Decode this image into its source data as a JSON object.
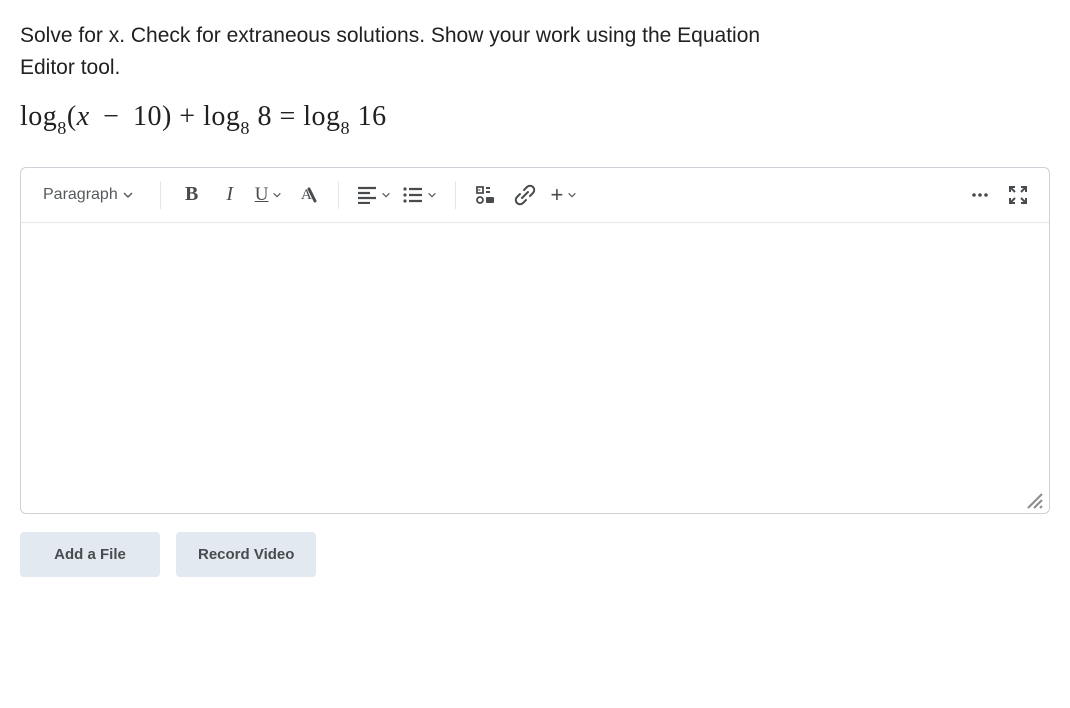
{
  "question": {
    "line1": "Solve for x.  Check for extraneous solutions.  Show your work using the Equation",
    "line2": "Editor tool."
  },
  "equation": {
    "parts": {
      "log": "log",
      "base": "8",
      "lp": "(",
      "x": "x",
      "minus": "−",
      "ten": "10",
      "rp": ")",
      "plus": "+",
      "eight": "8",
      "eq": "=",
      "sixteen": "16"
    }
  },
  "toolbar": {
    "paragraph": "Paragraph",
    "bold": "B",
    "italic": "I",
    "underline": "U",
    "textcolor": "A",
    "plus": "+"
  },
  "actions": {
    "addFile": "Add a File",
    "recordVideo": "Record Video"
  }
}
